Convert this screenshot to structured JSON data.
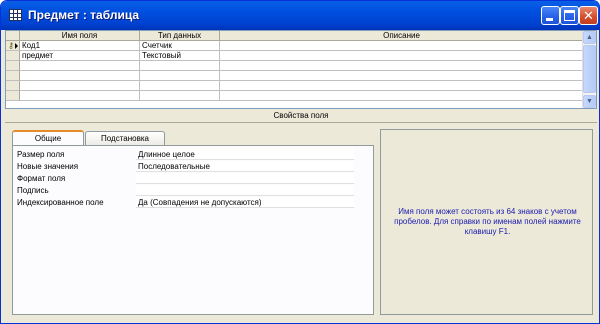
{
  "window": {
    "title": "Предмет : таблица"
  },
  "titlebar_buttons": {
    "close_glyph": "✕"
  },
  "grid": {
    "columns": [
      "Имя поля",
      "Тип данных",
      "Описание"
    ],
    "rows": [
      {
        "name": "Код1",
        "type": "Счетчик",
        "description": "",
        "primary_key": true
      },
      {
        "name": "предмет",
        "type": "Текстовый",
        "description": "",
        "primary_key": false
      },
      {
        "name": "",
        "type": "",
        "description": ""
      },
      {
        "name": "",
        "type": "",
        "description": ""
      },
      {
        "name": "",
        "type": "",
        "description": ""
      },
      {
        "name": "",
        "type": "",
        "description": ""
      }
    ]
  },
  "field_properties": {
    "title": "Свойства поля",
    "tabs": [
      "Общие",
      "Подстановка"
    ],
    "active_tab": "Общие",
    "properties": [
      {
        "label": "Размер поля",
        "value": "Длинное целое"
      },
      {
        "label": "Новые значения",
        "value": "Последовательные"
      },
      {
        "label": "Формат поля",
        "value": ""
      },
      {
        "label": "Подпись",
        "value": ""
      },
      {
        "label": "Индексированное поле",
        "value": "Да (Совпадения не допускаются)"
      }
    ],
    "help_text": "Имя поля может состоять из 64 знаков с учетом пробелов.  Для справки по именам полей нажмите клавишу F1."
  },
  "colors": {
    "title_bar": "#0050e0",
    "window_face": "#ece9d8",
    "help_text": "#1a1ab0",
    "close_button": "#d34d2d"
  },
  "icons": {
    "window": "table-icon",
    "key": "primary-key-icon",
    "row_selector": "row-selector-arrow-icon"
  }
}
